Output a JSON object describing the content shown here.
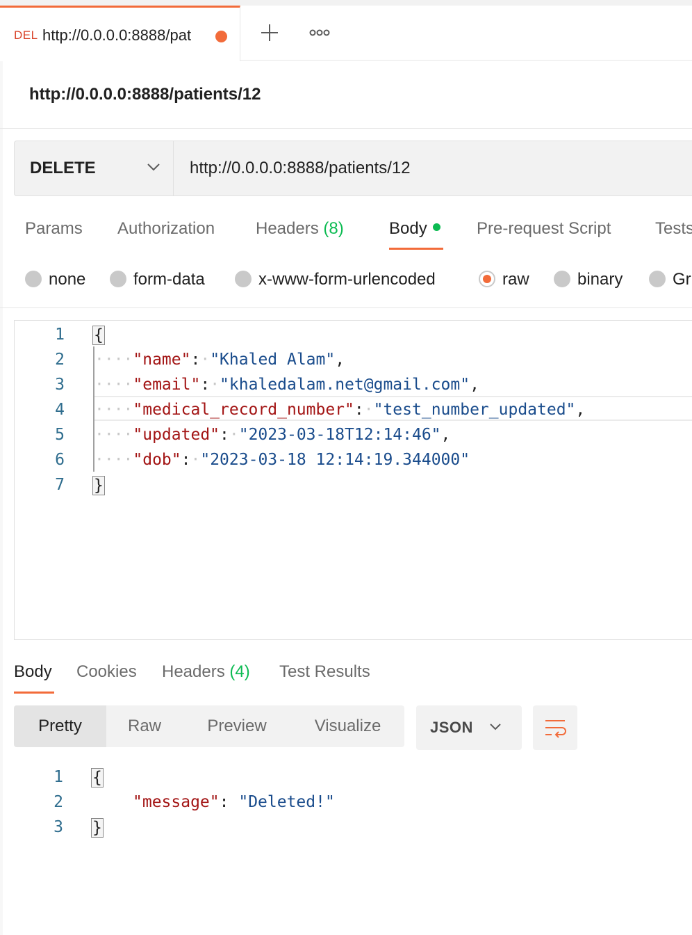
{
  "tab": {
    "method": "DEL",
    "url": "http://0.0.0.0:8888/pat"
  },
  "request": {
    "title": "http://0.0.0.0:8888/patients/12",
    "method": "DELETE",
    "url": "http://0.0.0.0:8888/patients/12"
  },
  "request_tabs": {
    "params": "Params",
    "authorization": "Authorization",
    "headers": "Headers",
    "headers_count": "(8)",
    "body": "Body",
    "pre_request": "Pre-request Script",
    "tests": "Tests"
  },
  "body_types": {
    "none": "none",
    "form_data": "form-data",
    "urlencoded": "x-www-form-urlencoded",
    "raw": "raw",
    "binary": "binary",
    "graphql": "Gr",
    "selected": "raw"
  },
  "request_body": {
    "line_numbers": [
      "1",
      "2",
      "3",
      "4",
      "5",
      "6",
      "7"
    ],
    "open_brace": "{",
    "close_brace": "}",
    "fields": [
      {
        "key": "\"name\"",
        "value": "\"Khaled Alam\"",
        "sep": ":",
        "end": ","
      },
      {
        "key": "\"email\"",
        "value": "\"khaledalam.net@gmail.com\"",
        "sep": ":",
        "end": ","
      },
      {
        "key": "\"medical_record_number\"",
        "value": "\"test_number_updated\"",
        "sep": ":",
        "end": ","
      },
      {
        "key": "\"updated\"",
        "value": "\"2023-03-18T12:14:46\"",
        "sep": ":",
        "end": ","
      },
      {
        "key": "\"dob\"",
        "value": "\"2023-03-18 12:14:19.344000\"",
        "sep": ":",
        "end": ""
      }
    ]
  },
  "response_tabs": {
    "body": "Body",
    "cookies": "Cookies",
    "headers": "Headers",
    "headers_count": "(4)",
    "test_results": "Test Results"
  },
  "response_view": {
    "pretty": "Pretty",
    "raw": "Raw",
    "preview": "Preview",
    "visualize": "Visualize",
    "format": "JSON"
  },
  "response_body": {
    "line_numbers": [
      "1",
      "2",
      "3"
    ],
    "open_brace": "{",
    "close_brace": "}",
    "key": "\"message\"",
    "sep": ":",
    "value": "\"Deleted!\""
  },
  "colors": {
    "accent": "#f26b3a",
    "method_delete": "#d9442b",
    "success_green": "#0cbb52",
    "json_key": "#a31515",
    "json_string": "#1a4c8c",
    "line_number": "#2f6d8e"
  }
}
